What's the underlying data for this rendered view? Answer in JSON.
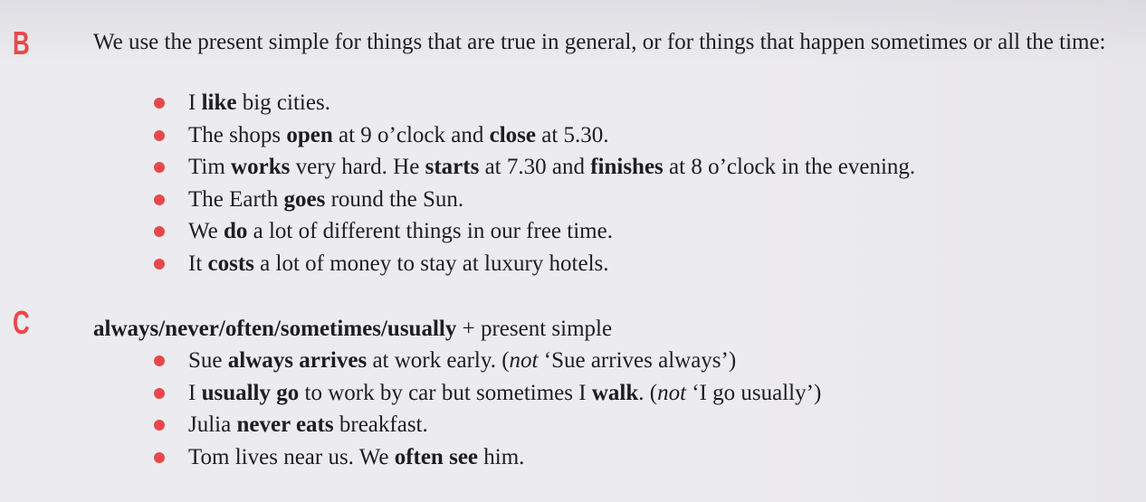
{
  "sections": {
    "b": {
      "letter": "B",
      "intro": "We use the present simple for things that are true in general, or for things that happen sometimes or all the time:",
      "examples": [
        [
          {
            "t": "I "
          },
          {
            "t": "like",
            "b": true
          },
          {
            "t": " big cities."
          }
        ],
        [
          {
            "t": "The shops "
          },
          {
            "t": "open",
            "b": true
          },
          {
            "t": " at 9 o’clock and "
          },
          {
            "t": "close",
            "b": true
          },
          {
            "t": " at 5.30."
          }
        ],
        [
          {
            "t": "Tim "
          },
          {
            "t": "works",
            "b": true
          },
          {
            "t": " very hard. He "
          },
          {
            "t": "starts",
            "b": true
          },
          {
            "t": " at 7.30 and "
          },
          {
            "t": "finishes",
            "b": true
          },
          {
            "t": " at 8 o’clock in the evening."
          }
        ],
        [
          {
            "t": "The Earth "
          },
          {
            "t": "goes",
            "b": true
          },
          {
            "t": " round the Sun."
          }
        ],
        [
          {
            "t": "We "
          },
          {
            "t": "do",
            "b": true
          },
          {
            "t": " a lot of different things in our free time."
          }
        ],
        [
          {
            "t": "It "
          },
          {
            "t": "costs",
            "b": true
          },
          {
            "t": " a lot of money to stay at luxury hotels."
          }
        ]
      ]
    },
    "c": {
      "letter": "C",
      "heading_bold": "always/never/often/sometimes/usually",
      "heading_rest": " + present simple",
      "examples": [
        [
          {
            "t": "Sue "
          },
          {
            "t": "always arrives",
            "b": true
          },
          {
            "t": " at work early. ("
          },
          {
            "t": "not",
            "i": true
          },
          {
            "t": " ‘Sue arrives always’)"
          }
        ],
        [
          {
            "t": "I "
          },
          {
            "t": "usually go",
            "b": true
          },
          {
            "t": " to work by car but sometimes I "
          },
          {
            "t": "walk",
            "b": true
          },
          {
            "t": ". ("
          },
          {
            "t": "not",
            "i": true
          },
          {
            "t": " ‘I go usually’)"
          }
        ],
        [
          {
            "t": "Julia "
          },
          {
            "t": "never eats",
            "b": true
          },
          {
            "t": " breakfast."
          }
        ],
        [
          {
            "t": "Tom lives near us. We "
          },
          {
            "t": "often see",
            "b": true
          },
          {
            "t": " him."
          }
        ]
      ]
    }
  },
  "colors": {
    "accent": "#e8484d",
    "text": "#1d1d22",
    "background": "#ecebef"
  }
}
